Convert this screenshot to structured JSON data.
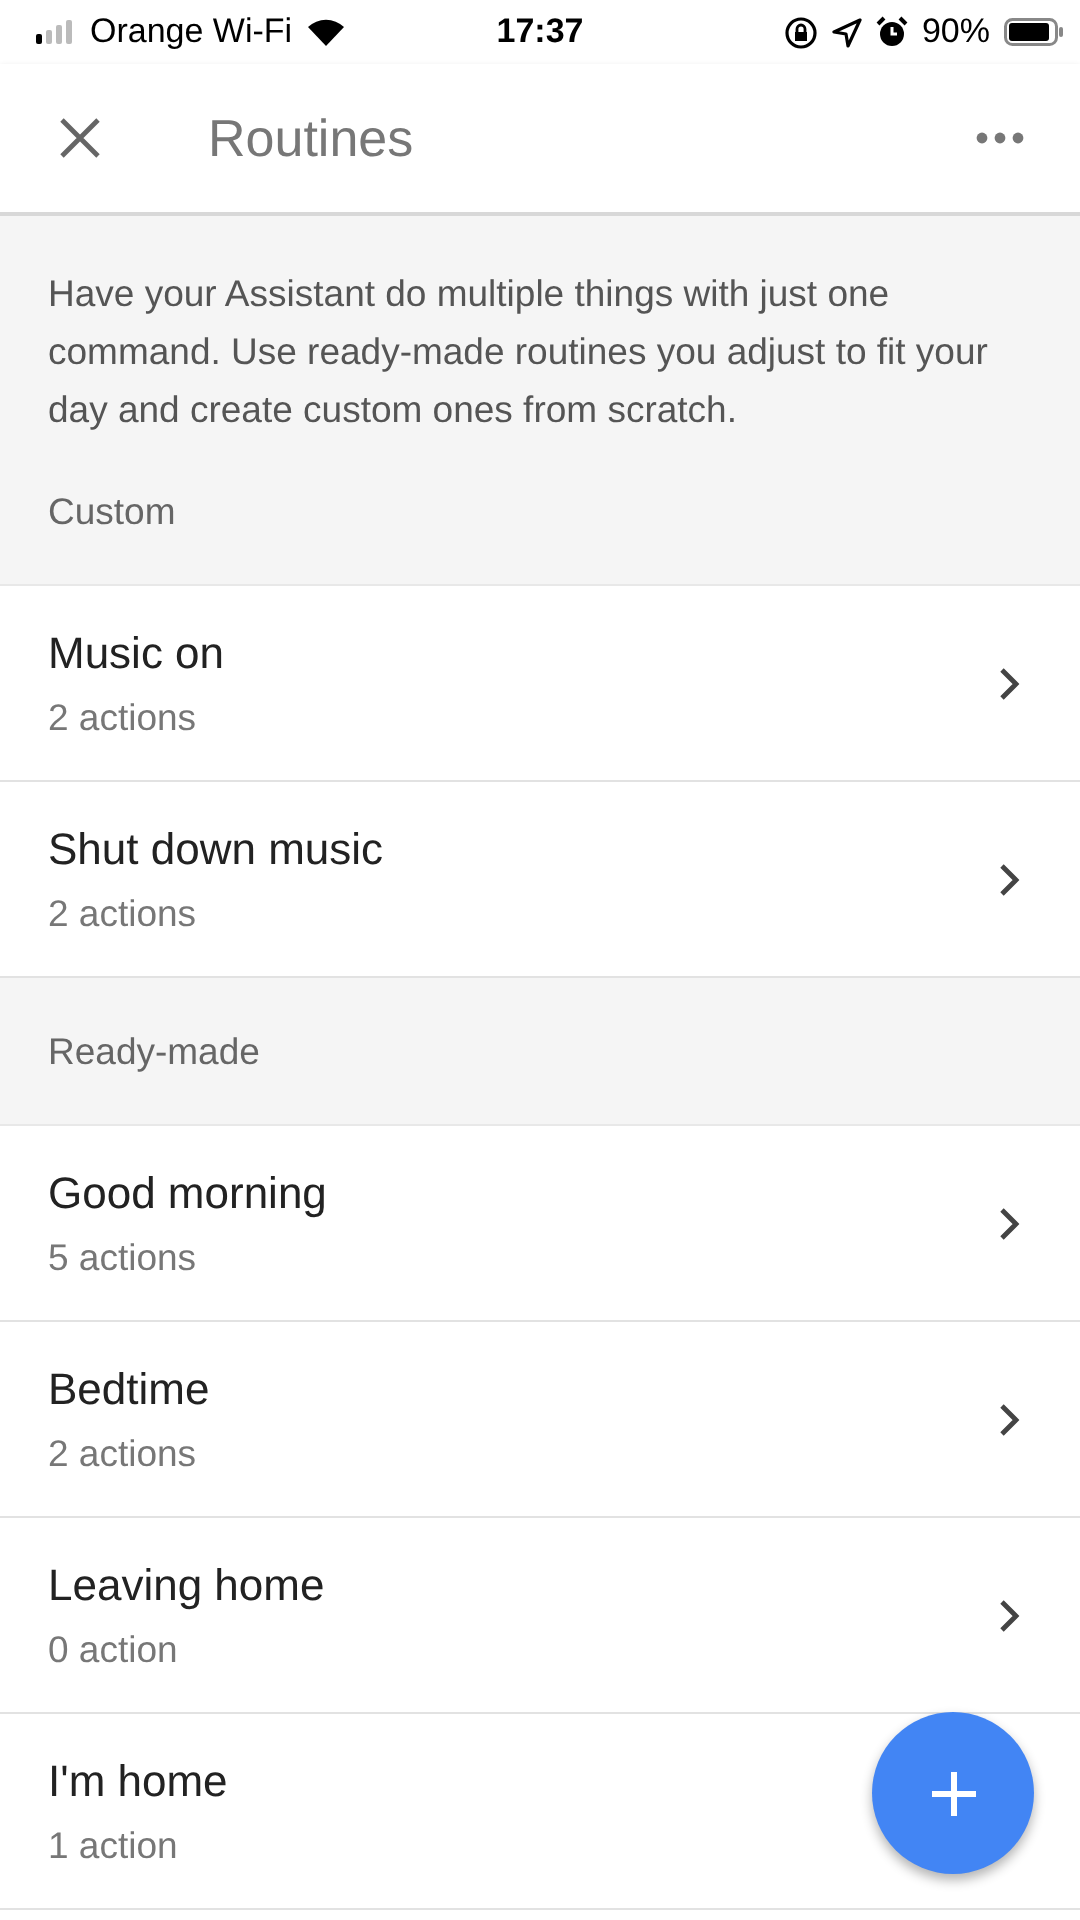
{
  "status_bar": {
    "carrier": "Orange Wi-Fi",
    "time": "17:37",
    "battery": "90%"
  },
  "header": {
    "title": "Routines"
  },
  "intro": "Have your Assistant do multiple things with just one command. Use ready-made routines you adjust to fit your day and create custom ones from scratch.",
  "sections": [
    {
      "title": "Custom",
      "items": [
        {
          "name": "Music on",
          "actions": "2 actions"
        },
        {
          "name": "Shut down music",
          "actions": "2 actions"
        }
      ]
    },
    {
      "title": "Ready-made",
      "items": [
        {
          "name": "Good morning",
          "actions": "5 actions"
        },
        {
          "name": "Bedtime",
          "actions": "2 actions"
        },
        {
          "name": "Leaving home",
          "actions": "0 action"
        },
        {
          "name": "I'm home",
          "actions": "1 action"
        }
      ]
    }
  ]
}
